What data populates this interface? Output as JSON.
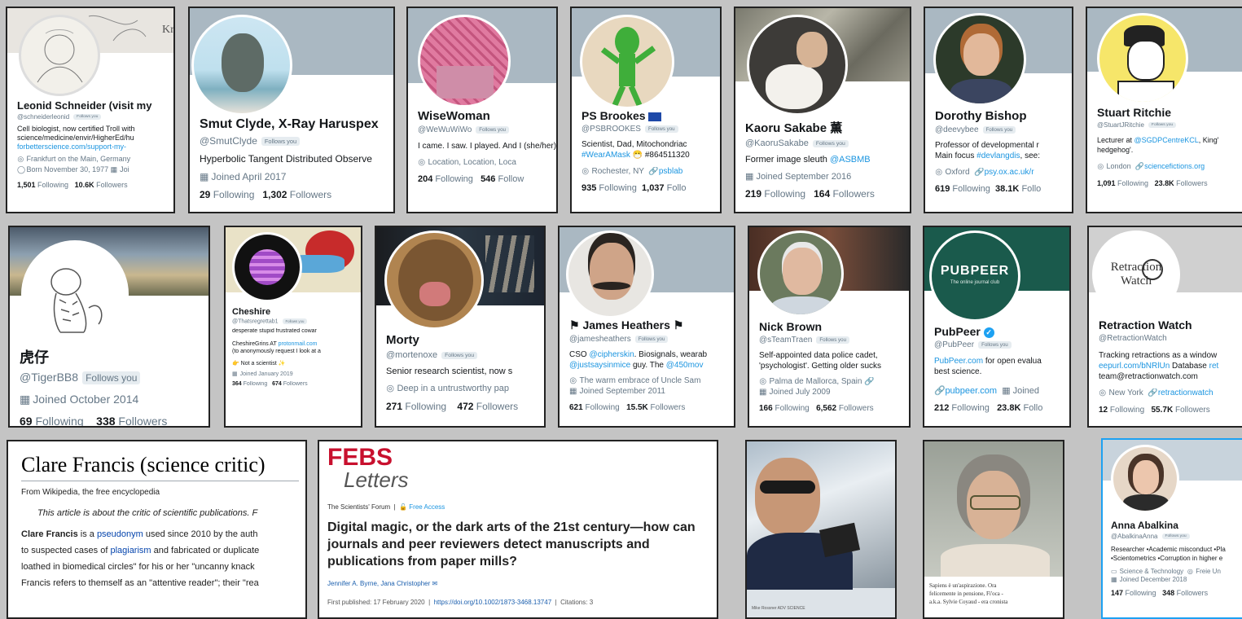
{
  "cards": {
    "c1": {
      "name": "Leonid Schneider (visit my",
      "handle": "@schneiderleonid",
      "fy": "Follows you",
      "bio": "Cell biologist, now certified Troll with science/medicine/envir/HigherEd/hu",
      "link": "forbetterscience.com/support-my-",
      "loc": "Frankfurt on the Main, Germany",
      "born": "Born November 30, 1977",
      "joined": "Joi",
      "following": "1,501",
      "followers": "10.6K",
      "following_label": "Following",
      "followers_label": "Followers"
    },
    "c2": {
      "name": "Smut Clyde, X-Ray Haruspex",
      "handle": "@SmutClyde",
      "fy": "Follows you",
      "bio": "Hyperbolic Tangent Distributed Observe",
      "joined": "Joined April 2017",
      "following": "29",
      "followers": "1,302",
      "following_label": "Following",
      "followers_label": "Followers"
    },
    "c3": {
      "name": "WiseWoman",
      "handle": "@WeWuWiWo",
      "fy": "Follows you",
      "bio": "I came. I saw. I played. And I (she/her)",
      "loc": "Location, Location, Loca",
      "following": "204",
      "followers": "546",
      "following_label": "Following",
      "followers_label": "Follow"
    },
    "c4": {
      "name": "PS Brookes",
      "handle": "@PSBROOKES",
      "fy": "Follows you",
      "bio1": "Scientist, Dad, Mitochondriac",
      "bio2": "#WearAMask",
      "bio3": "#864511320",
      "loc": "Rochester, NY",
      "link": "psblab",
      "following": "935",
      "followers": "1,037",
      "following_label": "Following",
      "followers_label": "Follo"
    },
    "c5": {
      "name": "Kaoru Sakabe",
      "name_suffix": "薫",
      "handle": "@KaoruSakabe",
      "fy": "Follows you",
      "bio": "Former image sleuth",
      "bio_link": "@ASBMB",
      "joined": "Joined September 2016",
      "following": "219",
      "followers": "164",
      "following_label": "Following",
      "followers_label": "Followers"
    },
    "c6": {
      "name": "Dorothy Bishop",
      "handle": "@deevybee",
      "fy": "Follows you",
      "bio1": "Professor of developmental r",
      "bio2": "Main focus",
      "bio_tag": "#devlangdis",
      "bio3": ", see:",
      "loc": "Oxford",
      "link": "psy.ox.ac.uk/r",
      "following": "619",
      "followers": "38.1K",
      "following_label": "Following",
      "followers_label": "Follo"
    },
    "c7": {
      "name": "Stuart Ritchie",
      "handle": "@StuartJRitchie",
      "fy": "Follows you",
      "bio1": "Lecturer at",
      "bio_link": "@SGDPCentreKCL",
      "bio2": ", King'",
      "bio3": "hedgehog'.",
      "loc": "London",
      "link": "sciencefictions.org",
      "following": "1,091",
      "followers": "23.8K",
      "following_label": "Following",
      "followers_label": "Followers"
    },
    "c8": {
      "name": "虎仔",
      "handle": "@TigerBB8",
      "fy": "Follows you",
      "joined": "Joined October 2014",
      "following": "69",
      "followers": "338",
      "following_label": "Following",
      "followers_label": "Followers"
    },
    "c9": {
      "name": "Cheshire",
      "handle": "@Thatsregrettab1",
      "fy": "Follows you",
      "bio": "desperate stupid frustrated cowar",
      "bio2": "CheshireGrins AT",
      "bio2_link": "protonmail.com",
      "bio3": "(to anonymously request I look at a",
      "bio4": "Not a scientist",
      "joined": "Joined January 2019",
      "following": "364",
      "followers": "674",
      "following_label": "Following",
      "followers_label": "Followers"
    },
    "c10": {
      "name": "Morty",
      "handle": "@mortenoxe",
      "fy": "Follows you",
      "bio": "Senior research scientist, now s",
      "loc": "Deep in a untrustworthy pap",
      "following": "271",
      "followers": "472",
      "following_label": "Following",
      "followers_label": "Followers"
    },
    "c11": {
      "name": "James Heathers",
      "handle": "@jamesheathers",
      "fy": "Follows you",
      "bio1": "CSO",
      "bio1_link": "@cipherskin",
      "bio1b": ". Biosignals, wearab",
      "bio2_link": "@justsaysinmice",
      "bio2": "guy. The",
      "bio2_link2": "@450mov",
      "loc": "The warm embrace of Uncle Sam",
      "joined": "Joined September 2011",
      "following": "621",
      "followers": "15.5K",
      "following_label": "Following",
      "followers_label": "Followers"
    },
    "c12": {
      "name": "Nick Brown",
      "handle": "@sTeamTraen",
      "fy": "Follows you",
      "bio": "Self-appointed data police cadet, 'psychologist'. Getting older sucks",
      "loc": "Palma de Mallorca, Spain",
      "joined": "Joined July 2009",
      "following": "166",
      "followers": "6,562",
      "following_label": "Following",
      "followers_label": "Followers"
    },
    "c13": {
      "name": "PubPeer",
      "handle": "@PubPeer",
      "fy": "Follows you",
      "logo": "PUBPEER",
      "logo_sub": "The online journal club",
      "bio_link": "PubPeer.com",
      "bio": "for open evalua",
      "bio2": "best science.",
      "link": "pubpeer.com",
      "joined": "Joined",
      "following": "212",
      "followers": "23.8K",
      "following_label": "Following",
      "followers_label": "Follo"
    },
    "c14": {
      "name": "Retraction Watch",
      "handle": "@RetractionWatch",
      "logo1": "Retraction",
      "logo2": "Watch",
      "bio": "Tracking retractions as a window",
      "bio_link": "eepurl.com/bNRlUn",
      "bio2": "Database",
      "bio2_link": "ret",
      "bio3": "team@retractionwatch.com",
      "loc": "New York",
      "link": "retractionwatch",
      "following": "12",
      "followers": "55.7K",
      "following_label": "Following",
      "followers_label": "Followers"
    },
    "c15": {
      "title": "Clare Francis (science critic)",
      "sub": "From Wikipedia, the free encyclopedia",
      "hat": "This article is about the critic of scientific publications. F",
      "p1b": "Clare Francis",
      "p1a": " is a ",
      "p1link": "pseudonym",
      "p1c": " used since 2010 by the auth",
      "p2a": "to suspected cases of ",
      "p2link": "plagiarism",
      "p2b": " and fabricated or duplicate",
      "p3": "loathed in biomedical circles\" for his or her \"uncanny knack",
      "p4": "Francis refers to themself as an \"attentive reader\"; their \"rea"
    },
    "c16": {
      "logo1": "FEBS",
      "logo2": "Letters",
      "forum": "The Scientists' Forum",
      "access": "Free Access",
      "title": "Digital magic, or the dark arts of the 21st century—how can journals and peer reviewers detect manuscripts and publications from paper mills?",
      "authors": "Jennifer A. Byrne, Jana Christopher",
      "pub": "First published: 17 February 2020",
      "doi": "https://doi.org/10.1002/1873-3468.13747",
      "cit": "Citations: 3"
    },
    "c17": {
      "caption": "Mike Rossner   ADV SCIENCE"
    },
    "c18": {
      "cap1": "Sapiens è un'aspirazione. Ora",
      "cap2": "felicemente in pensione, Fi'oca -",
      "cap3": "a.k.a. Sylvie Coyaud - era cronista"
    },
    "c19": {
      "name": "Anna Abalkina",
      "handle": "@AbalkinaAnna",
      "fy": "Follows you",
      "bio1": "Researcher •Academic misconduct •Pla",
      "bio2": "•Scientometrics •Corruption in higher e",
      "loc": "Science & Technology",
      "loc2": "Freie Un",
      "joined": "Joined December 2018",
      "following": "147",
      "followers": "348",
      "following_label": "Following",
      "followers_label": "Followers"
    }
  },
  "colors": {
    "link": "#1b95e0",
    "muted": "#657786",
    "banner_grey": "#aab8c2",
    "pubpeer": "#1a5a4c"
  }
}
